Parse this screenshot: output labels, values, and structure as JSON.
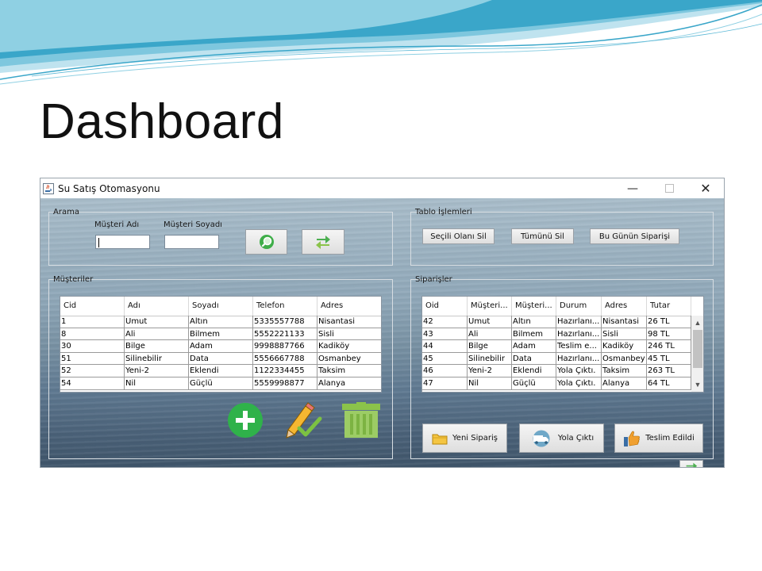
{
  "slide": {
    "title": "Dashboard"
  },
  "window": {
    "title": "Su Satış Otomasyonu",
    "minimize_glyph": "—",
    "close_glyph": "✕",
    "icon": "java-cup-icon"
  },
  "arama": {
    "label": "Arama",
    "first_name_label": "Müşteri Adı",
    "last_name_label": "Müşteri Soyadı",
    "first_name_value": "",
    "last_name_value": "",
    "search_icon": "magnifier-icon",
    "refresh_icon": "refresh-icon"
  },
  "tablo_islemleri": {
    "label": "Tablo İşlemleri",
    "delete_selected": "Seçili Olanı Sil",
    "delete_all": "Tümünü Sil",
    "todays_orders": "Bu Günün Siparişi"
  },
  "musteriler": {
    "label": "Müşteriler",
    "columns": [
      "Cid",
      "Adı",
      "Soyadı",
      "Telefon",
      "Adres"
    ],
    "rows": [
      [
        "1",
        "Umut",
        "Altın",
        "5335557788",
        "Nisantasi"
      ],
      [
        "8",
        "Ali",
        "Bilmem",
        "5552221133",
        "Sisli"
      ],
      [
        "30",
        "Bilge",
        "Adam",
        "9998887766",
        "Kadiköy"
      ],
      [
        "51",
        "Silinebilir",
        "Data",
        "5556667788",
        "Osmanbey"
      ],
      [
        "52",
        "Yeni-2",
        "Eklendi",
        "1122334455",
        "Taksim"
      ],
      [
        "54",
        "Nil",
        "Güçlü",
        "5559998877",
        "Alanya"
      ]
    ],
    "add_icon": "plus-circle-icon",
    "edit_icon": "pencil-check-icon",
    "delete_icon": "trash-icon"
  },
  "siparisler": {
    "label": "Siparişler",
    "columns": [
      "Oid",
      "Müşteri...",
      "Müşteri...",
      "Durum",
      "Adres",
      "Tutar"
    ],
    "rows": [
      [
        "42",
        "Umut",
        "Altın",
        "Hazırlanı...",
        "Nisantasi",
        "26 TL"
      ],
      [
        "43",
        "Ali",
        "Bilmem",
        "Hazırlanı...",
        "Sisli",
        "98 TL"
      ],
      [
        "44",
        "Bilge",
        "Adam",
        "Teslim e...",
        "Kadiköy",
        "246 TL"
      ],
      [
        "45",
        "Silinebilir",
        "Data",
        "Hazırlanı...",
        "Osmanbey",
        "45 TL"
      ],
      [
        "46",
        "Yeni-2",
        "Eklendi",
        "Yola Çıktı.",
        "Taksim",
        "263 TL"
      ],
      [
        "47",
        "Nil",
        "Güçlü",
        "Yola Çıktı.",
        "Alanya",
        "64 TL"
      ]
    ],
    "new_order": "Yeni Sipariş",
    "on_the_way": "Yola Çıktı",
    "delivered": "Teslim Edildi",
    "new_order_icon": "folder-icon",
    "on_the_way_icon": "truck-icon",
    "delivered_icon": "thumbs-up-icon",
    "refresh_icon": "refresh-icon"
  },
  "colors": {
    "accent_green": "#2fb24a",
    "refresh_green": "#4caf50",
    "sea_top": "#a9bdca",
    "sea_bottom": "#3f556a"
  }
}
